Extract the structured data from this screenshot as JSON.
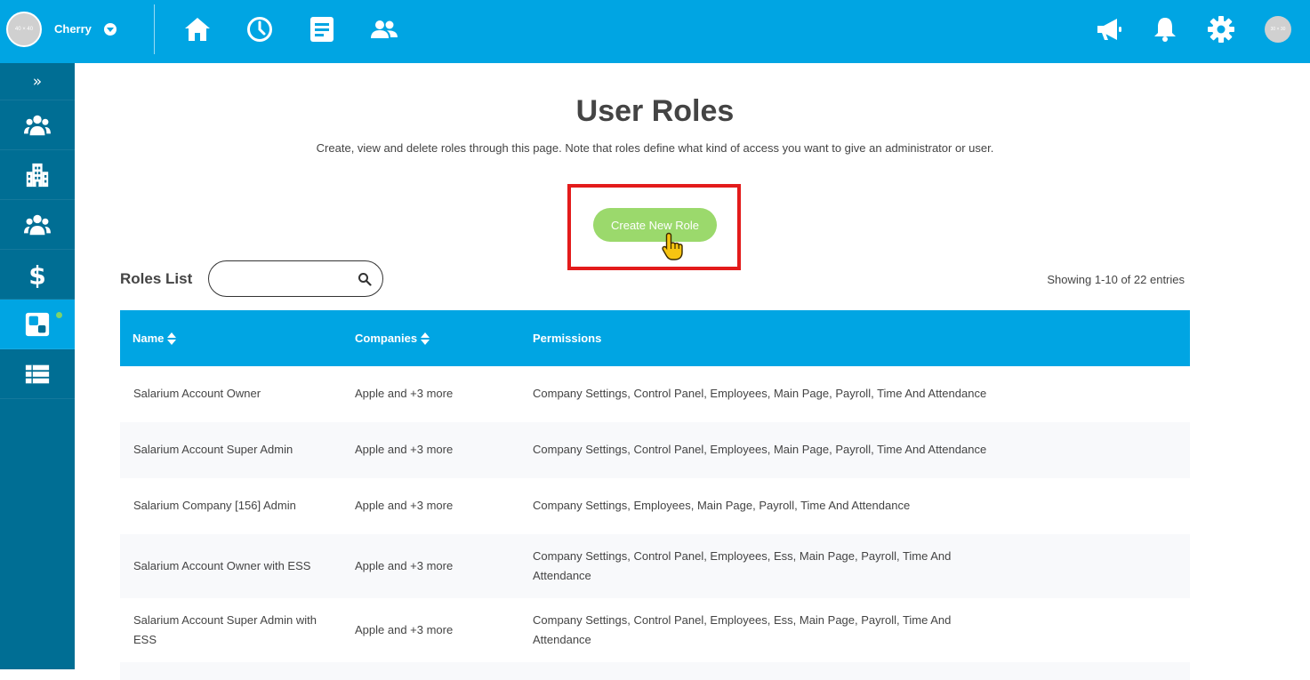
{
  "header": {
    "user_name": "Cherry",
    "avatar_text": "40 × 40",
    "right_avatar_text": "30 × 30",
    "nav_icons": [
      "home-icon",
      "clock-icon",
      "document-icon",
      "people-icon"
    ],
    "right_icons": [
      "megaphone-icon",
      "bell-icon",
      "gear-icon"
    ]
  },
  "sidebar": {
    "expand_label": "»",
    "items": [
      "people-group-icon",
      "building-icon",
      "people-group-icon",
      "dollar-icon",
      "control-panel-icon",
      "list-icon"
    ],
    "active_index": 4
  },
  "page": {
    "title": "User Roles",
    "subtitle": "Create, view and delete roles through this page. Note that roles define what kind of access you want to give an administrator or user.",
    "create_button": "Create New Role",
    "roles_list_label": "Roles List",
    "search_placeholder": "",
    "entries_text": "Showing 1-10 of 22 entries"
  },
  "table": {
    "headers": {
      "name": "Name",
      "companies": "Companies",
      "permissions": "Permissions"
    },
    "rows": [
      {
        "name_line1": "Salarium Account Owner",
        "name_line2": "",
        "companies": "Apple and +3 more",
        "perm_line1": "Company Settings, Control Panel, Employees, Main Page, Payroll, Time And Attendance",
        "perm_line2": ""
      },
      {
        "name_line1": "Salarium Account Super Admin",
        "name_line2": "",
        "companies": "Apple and +3 more",
        "perm_line1": "Company Settings, Control Panel, Employees, Main Page, Payroll, Time And Attendance",
        "perm_line2": ""
      },
      {
        "name_line1": "Salarium Company [156] Admin",
        "name_line2": "",
        "companies": "Apple and +3 more",
        "perm_line1": "Company Settings, Employees, Main Page, Payroll, Time And Attendance",
        "perm_line2": ""
      },
      {
        "name_line1": "Salarium Account Owner with ESS",
        "name_line2": "",
        "companies": "Apple and +3 more",
        "perm_line1": "Company Settings, Control Panel, Employees, Ess, Main Page, Payroll, Time And",
        "perm_line2": "Attendance"
      },
      {
        "name_line1": "Salarium Account Super Admin with",
        "name_line2": "ESS",
        "companies": "Apple and +3 more",
        "perm_line1": "Company Settings, Control Panel, Employees, Ess, Main Page, Payroll, Time And",
        "perm_line2": "Attendance"
      }
    ]
  },
  "colors": {
    "primary": "#00a5e3",
    "sidebar": "#006e94",
    "button": "#9bd96c",
    "highlight": "#e31b1b"
  }
}
